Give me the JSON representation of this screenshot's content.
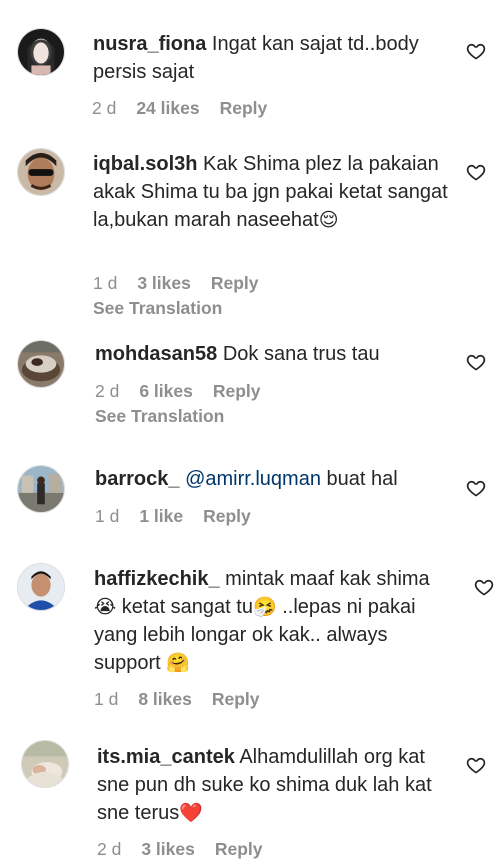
{
  "comments": [
    {
      "username": "nusra_fiona",
      "text": "Ingat kan sajat td..body persis sajat",
      "time": "2 d",
      "likes": "24 likes",
      "reply": "Reply"
    },
    {
      "username": "iqbal.sol3h",
      "text": "Kak Shima plez la pakaian akak Shima tu ba jgn pakai ketat sangat la,bukan marah naseehat",
      "emoji": "😌",
      "time": "1 d",
      "likes": "3 likes",
      "reply": "Reply",
      "see_translation": "See Translation"
    },
    {
      "username": "mohdasan58",
      "text": "Dok sana trus tau",
      "time": "2 d",
      "likes": "6 likes",
      "reply": "Reply",
      "see_translation": "See Translation"
    },
    {
      "username": "barrock_",
      "mention": "@amirr.luqman",
      "text": "buat hal",
      "time": "1 d",
      "likes": "1 like",
      "reply": "Reply"
    },
    {
      "username": "haffizkechik_",
      "text_a": "mintak maaf kak shima",
      "emoji_a": "😭",
      "text_b": "ketat sangat tu",
      "emoji_b": "🤧",
      "text_c": "..lepas ni pakai yang lebih longar ok kak.. always support",
      "emoji_c": "🤗",
      "time": "1 d",
      "likes": "8 likes",
      "reply": "Reply"
    },
    {
      "username": "its.mia_cantek",
      "text": "Alhamdulillah org kat sne pun dh suke ko shima duk lah kat sne terus",
      "emoji": "❤️",
      "time": "2 d",
      "likes": "3 likes",
      "reply": "Reply"
    }
  ],
  "icons": {
    "like": "heart-outline-icon"
  },
  "colors": {
    "text": "#262626",
    "meta": "#8e8e8e",
    "mention": "#00376b",
    "heart_emoji": "#e0245e"
  }
}
